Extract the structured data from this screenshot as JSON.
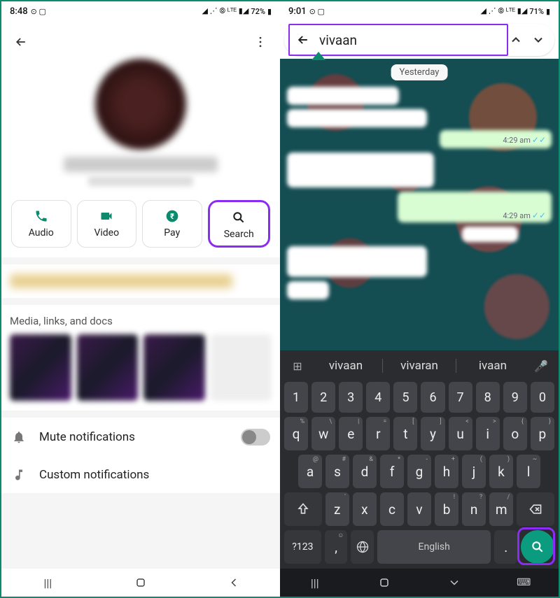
{
  "left": {
    "status": {
      "time": "8:48",
      "icons_left": "◎ ▣",
      "icons_right": "▲ ₪ ⊚ ᵛᵒᴸᵀᴱ 📶 72% ▮",
      "battery": "72%"
    },
    "actions": [
      {
        "label": "Audio"
      },
      {
        "label": "Video"
      },
      {
        "label": "Pay"
      },
      {
        "label": "Search"
      }
    ],
    "media_title": "Media, links, and docs",
    "settings": {
      "mute": "Mute notifications",
      "custom": "Custom notifications"
    }
  },
  "right": {
    "status": {
      "time": "9:01",
      "icons_left": "◎ ▣",
      "battery": "71%"
    },
    "search_value": "vivaan",
    "date_label": "Yesterday",
    "messages": {
      "time1": "4:29 am",
      "time2": "4:29 am"
    },
    "suggestions": [
      "vivaan",
      "vivaran",
      "ivaan"
    ],
    "keyboard": {
      "num_row": [
        "1",
        "2",
        "3",
        "4",
        "5",
        "6",
        "7",
        "8",
        "9",
        "0"
      ],
      "row1": [
        "q",
        "w",
        "e",
        "r",
        "t",
        "y",
        "u",
        "i",
        "o",
        "p"
      ],
      "row1_sup": [
        "%",
        "\\",
        "|",
        "=",
        "[",
        "]",
        "<",
        ">",
        "{",
        "}"
      ],
      "row2": [
        "a",
        "s",
        "d",
        "f",
        "g",
        "h",
        "j",
        "k",
        "l"
      ],
      "row2_sup": [
        "@",
        "#",
        "&",
        "*",
        "-",
        "+",
        "(",
        ")",
        "~"
      ],
      "row3": [
        "z",
        "x",
        "c",
        "v",
        "b",
        "n",
        "m"
      ],
      "symbols_key": "?123",
      "space_label": "English"
    }
  }
}
